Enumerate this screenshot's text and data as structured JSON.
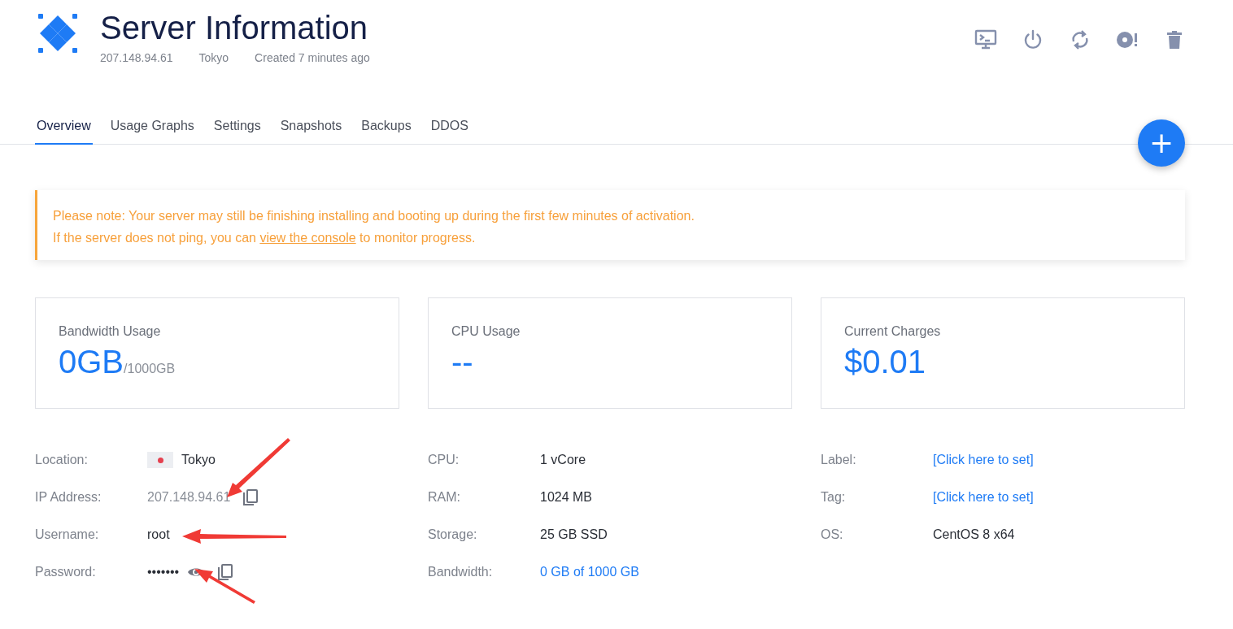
{
  "header": {
    "title": "Server Information",
    "meta": [
      "207.148.94.61",
      "Tokyo",
      "Created 7 minutes ago"
    ]
  },
  "tabs": [
    {
      "label": "Overview",
      "selected": true
    },
    {
      "label": "Usage Graphs",
      "selected": false
    },
    {
      "label": "Settings",
      "selected": false
    },
    {
      "label": "Snapshots",
      "selected": false
    },
    {
      "label": "Backups",
      "selected": false
    },
    {
      "label": "DDOS",
      "selected": false
    }
  ],
  "fab": {
    "symbol": "+"
  },
  "notice": {
    "line1": "Please note: Your server may still be finishing installing and booting up during the first few minutes of activation.",
    "line2_before": "If the server does not ping, you can ",
    "link": "view the console",
    "line2_after": " to monitor progress."
  },
  "stats": [
    {
      "label": "Bandwidth Usage",
      "value": "0GB",
      "unit": "/1000GB"
    },
    {
      "label": "CPU Usage",
      "value": "--"
    },
    {
      "label": "Current Charges",
      "value": "$0.01"
    }
  ],
  "details": [
    [
      {
        "label": "Location:",
        "value": "Tokyo",
        "kind": "flag"
      },
      {
        "label": "IP Address:",
        "value": "207.148.94.61",
        "kind": "copy"
      },
      {
        "label": "Username:",
        "value": "root",
        "kind": "text"
      },
      {
        "label": "Password:",
        "value": "•••••••",
        "kind": "password"
      }
    ],
    [
      {
        "label": "CPU:",
        "value": "1 vCore",
        "kind": "text"
      },
      {
        "label": "RAM:",
        "value": "1024 MB",
        "kind": "text"
      },
      {
        "label": "Storage:",
        "value": "25 GB SSD",
        "kind": "text"
      },
      {
        "label": "Bandwidth:",
        "value": "0 GB of 1000 GB",
        "kind": "link"
      }
    ],
    [
      {
        "label": "Label:",
        "value": "[Click here to set]",
        "kind": "link"
      },
      {
        "label": "Tag:",
        "value": "[Click here to set]",
        "kind": "link"
      },
      {
        "label": "OS:",
        "value": "CentOS 8 x64",
        "kind": "text"
      }
    ]
  ]
}
